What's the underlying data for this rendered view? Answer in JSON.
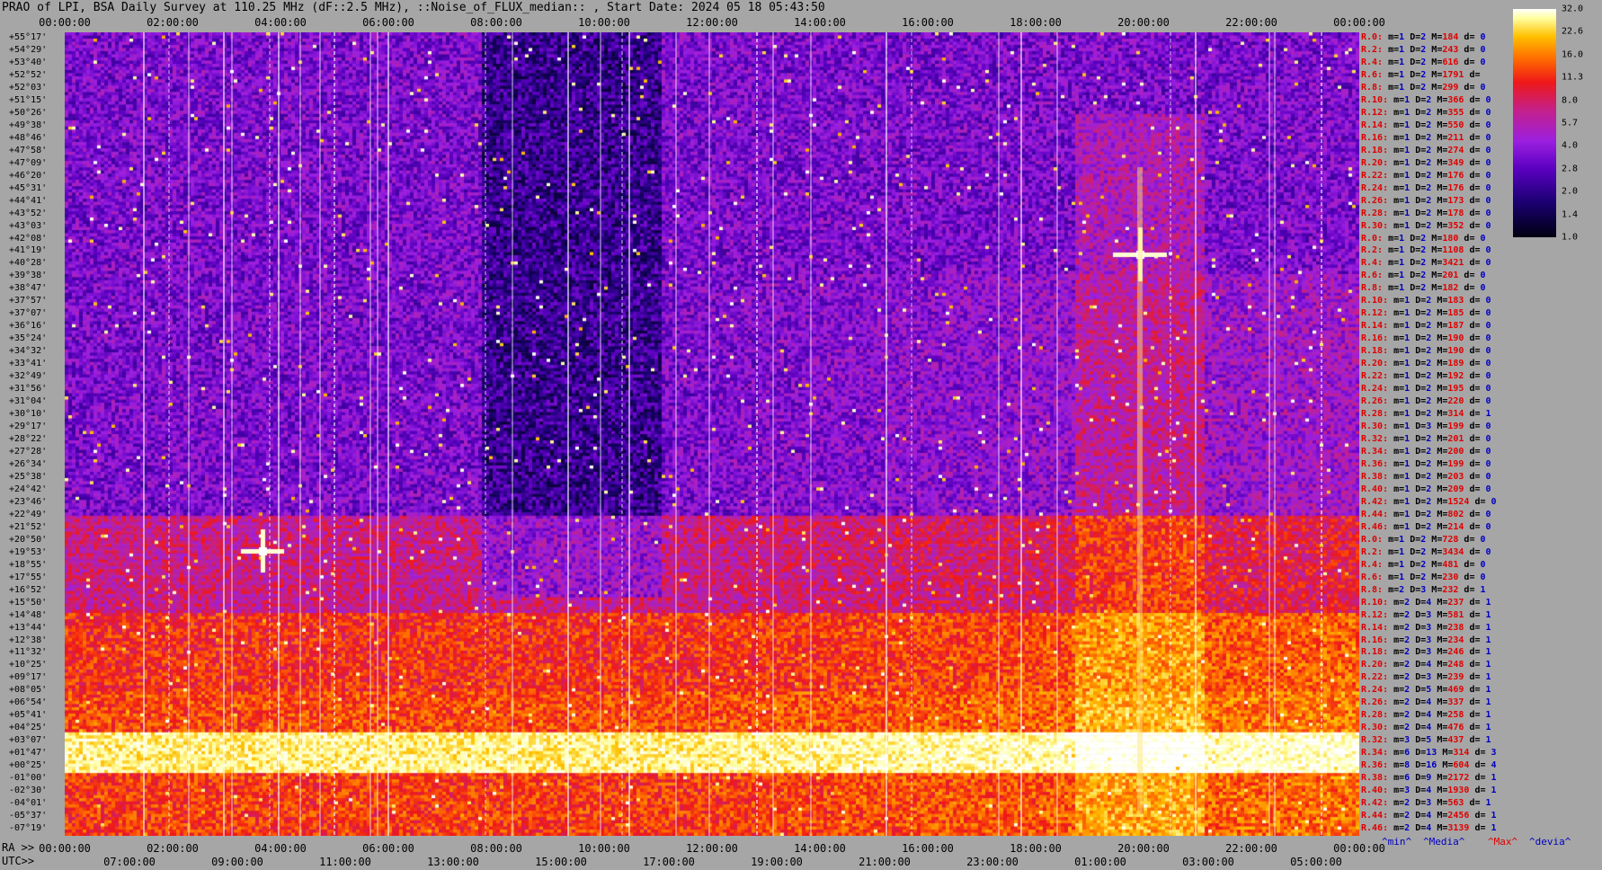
{
  "title": "PRAO of LPI, BSA Daily Survey at 110.25 MHz (dF::2.5 MHz), ::Noise_of_FLUX_median:: , Start Date: 2024 05 18 05:43:50",
  "chart_data": {
    "type": "heatmap",
    "top_axis_ticks": [
      "00:00:00",
      "02:00:00",
      "04:00:00",
      "06:00:00",
      "08:00:00",
      "10:00:00",
      "12:00:00",
      "14:00:00",
      "16:00:00",
      "18:00:00",
      "20:00:00",
      "22:00:00",
      "00:00:00"
    ],
    "ra_row_label": "RA >>",
    "ra_ticks": [
      "00:00:00",
      "02:00:00",
      "04:00:00",
      "06:00:00",
      "08:00:00",
      "10:00:00",
      "12:00:00",
      "14:00:00",
      "16:00:00",
      "18:00:00",
      "20:00:00",
      "22:00:00",
      "00:00:00"
    ],
    "utc_row_label": "UTC>>",
    "utc_ticks": [
      "07:00:00",
      "09:00:00",
      "11:00:00",
      "13:00:00",
      "15:00:00",
      "17:00:00",
      "19:00:00",
      "21:00:00",
      "23:00:00",
      "01:00:00",
      "03:00:00",
      "05:00:00"
    ],
    "declinations": [
      "+55°17'",
      "+54°29'",
      "+53°40'",
      "+52°52'",
      "+52°03'",
      "+51°15'",
      "+50°26'",
      "+49°38'",
      "+48°46'",
      "+47°58'",
      "+47°09'",
      "+46°20'",
      "+45°31'",
      "+44°41'",
      "+43°52'",
      "+43°03'",
      "+42°08'",
      "+41°19'",
      "+40°28'",
      "+39°38'",
      "+38°47'",
      "+37°57'",
      "+37°07'",
      "+36°16'",
      "+35°24'",
      "+34°32'",
      "+33°41'",
      "+32°49'",
      "+31°56'",
      "+31°04'",
      "+30°10'",
      "+29°17'",
      "+28°22'",
      "+27°28'",
      "+26°34'",
      "+25°38'",
      "+24°42'",
      "+23°46'",
      "+22°49'",
      "+21°52'",
      "+20°50'",
      "+19°53'",
      "+18°55'",
      "+17°55'",
      "+16°52'",
      "+15°50'",
      "+14°48'",
      "+13°44'",
      "+12°38'",
      "+11°32'",
      "+10°25'",
      "+09°17'",
      "+08°05'",
      "+06°54'",
      "+05°41'",
      "+04°25'",
      "+03°07'",
      "+01°47'",
      "+00°25'",
      "-01°00'",
      "-02°30'",
      "-04°01'",
      "-05°37'",
      "-07°19'"
    ],
    "colorbar_ticks": [
      "32.0",
      "22.6",
      "16.0",
      "11.3",
      "8.0",
      "5.7",
      "4.0",
      "2.8",
      "2.0",
      "1.4",
      "1.0"
    ],
    "colorbar_colors": [
      "#000010",
      "#1a0070",
      "#5a00c0",
      "#9b1fe0",
      "#c2208f",
      "#ef1818",
      "#ff6a00",
      "#ffc000",
      "#ffffa0",
      "#ffffff"
    ],
    "row_stats": [
      {
        "r": "R.0:",
        "m": "1",
        "D": "2",
        "M": "184",
        "d": "0"
      },
      {
        "r": "R.2:",
        "m": "1",
        "D": "2",
        "M": "243",
        "d": "0"
      },
      {
        "r": "R.4:",
        "m": "1",
        "D": "2",
        "M": "616",
        "d": "0"
      },
      {
        "r": "R.6:",
        "m": "1",
        "D": "2",
        "M": "1791",
        "d": ""
      },
      {
        "r": "R.8:",
        "m": "1",
        "D": "2",
        "M": "299",
        "d": "0"
      },
      {
        "r": "R.10:",
        "m": "1",
        "D": "2",
        "M": "366",
        "d": "0"
      },
      {
        "r": "R.12:",
        "m": "1",
        "D": "2",
        "M": "355",
        "d": "0"
      },
      {
        "r": "R.14:",
        "m": "1",
        "D": "2",
        "M": "550",
        "d": "0"
      },
      {
        "r": "R.16:",
        "m": "1",
        "D": "2",
        "M": "211",
        "d": "0"
      },
      {
        "r": "R.18:",
        "m": "1",
        "D": "2",
        "M": "274",
        "d": "0"
      },
      {
        "r": "R.20:",
        "m": "1",
        "D": "2",
        "M": "349",
        "d": "0"
      },
      {
        "r": "R.22:",
        "m": "1",
        "D": "2",
        "M": "176",
        "d": "0"
      },
      {
        "r": "R.24:",
        "m": "1",
        "D": "2",
        "M": "176",
        "d": "0"
      },
      {
        "r": "R.26:",
        "m": "1",
        "D": "2",
        "M": "173",
        "d": "0"
      },
      {
        "r": "R.28:",
        "m": "1",
        "D": "2",
        "M": "178",
        "d": "0"
      },
      {
        "r": "R.30:",
        "m": "1",
        "D": "2",
        "M": "352",
        "d": "0"
      },
      {
        "r": "R.0:",
        "m": "1",
        "D": "2",
        "M": "180",
        "d": "0"
      },
      {
        "r": "R.2:",
        "m": "1",
        "D": "2",
        "M": "1108",
        "d": "0"
      },
      {
        "r": "R.4:",
        "m": "1",
        "D": "2",
        "M": "3421",
        "d": "0"
      },
      {
        "r": "R.6:",
        "m": "1",
        "D": "2",
        "M": "201",
        "d": "0"
      },
      {
        "r": "R.8:",
        "m": "1",
        "D": "2",
        "M": "182",
        "d": "0"
      },
      {
        "r": "R.10:",
        "m": "1",
        "D": "2",
        "M": "183",
        "d": "0"
      },
      {
        "r": "R.12:",
        "m": "1",
        "D": "2",
        "M": "185",
        "d": "0"
      },
      {
        "r": "R.14:",
        "m": "1",
        "D": "2",
        "M": "187",
        "d": "0"
      },
      {
        "r": "R.16:",
        "m": "1",
        "D": "2",
        "M": "190",
        "d": "0"
      },
      {
        "r": "R.18:",
        "m": "1",
        "D": "2",
        "M": "190",
        "d": "0"
      },
      {
        "r": "R.20:",
        "m": "1",
        "D": "2",
        "M": "189",
        "d": "0"
      },
      {
        "r": "R.22:",
        "m": "1",
        "D": "2",
        "M": "192",
        "d": "0"
      },
      {
        "r": "R.24:",
        "m": "1",
        "D": "2",
        "M": "195",
        "d": "0"
      },
      {
        "r": "R.26:",
        "m": "1",
        "D": "2",
        "M": "220",
        "d": "0"
      },
      {
        "r": "R.28:",
        "m": "1",
        "D": "2",
        "M": "314",
        "d": "1"
      },
      {
        "r": "R.30:",
        "m": "1",
        "D": "3",
        "M": "199",
        "d": "0"
      },
      {
        "r": "R.32:",
        "m": "1",
        "D": "2",
        "M": "201",
        "d": "0"
      },
      {
        "r": "R.34:",
        "m": "1",
        "D": "2",
        "M": "200",
        "d": "0"
      },
      {
        "r": "R.36:",
        "m": "1",
        "D": "2",
        "M": "199",
        "d": "0"
      },
      {
        "r": "R.38:",
        "m": "1",
        "D": "2",
        "M": "203",
        "d": "0"
      },
      {
        "r": "R.40:",
        "m": "1",
        "D": "2",
        "M": "209",
        "d": "0"
      },
      {
        "r": "R.42:",
        "m": "1",
        "D": "2",
        "M": "1524",
        "d": "0"
      },
      {
        "r": "R.44:",
        "m": "1",
        "D": "2",
        "M": "802",
        "d": "0"
      },
      {
        "r": "R.46:",
        "m": "1",
        "D": "2",
        "M": "214",
        "d": "0"
      },
      {
        "r": "R.0:",
        "m": "1",
        "D": "2",
        "M": "728",
        "d": "0"
      },
      {
        "r": "R.2:",
        "m": "1",
        "D": "2",
        "M": "3434",
        "d": "0"
      },
      {
        "r": "R.4:",
        "m": "1",
        "D": "2",
        "M": "481",
        "d": "0"
      },
      {
        "r": "R.6:",
        "m": "1",
        "D": "2",
        "M": "230",
        "d": "0"
      },
      {
        "r": "R.8:",
        "m": "2",
        "D": "3",
        "M": "232",
        "d": "1"
      },
      {
        "r": "R.10:",
        "m": "2",
        "D": "4",
        "M": "237",
        "d": "1"
      },
      {
        "r": "R.12:",
        "m": "2",
        "D": "3",
        "M": "581",
        "d": "1"
      },
      {
        "r": "R.14:",
        "m": "2",
        "D": "3",
        "M": "238",
        "d": "1"
      },
      {
        "r": "R.16:",
        "m": "2",
        "D": "3",
        "M": "234",
        "d": "1"
      },
      {
        "r": "R.18:",
        "m": "2",
        "D": "3",
        "M": "246",
        "d": "1"
      },
      {
        "r": "R.20:",
        "m": "2",
        "D": "4",
        "M": "248",
        "d": "1"
      },
      {
        "r": "R.22:",
        "m": "2",
        "D": "3",
        "M": "239",
        "d": "1"
      },
      {
        "r": "R.24:",
        "m": "2",
        "D": "5",
        "M": "469",
        "d": "1"
      },
      {
        "r": "R.26:",
        "m": "2",
        "D": "4",
        "M": "337",
        "d": "1"
      },
      {
        "r": "R.28:",
        "m": "2",
        "D": "4",
        "M": "258",
        "d": "1"
      },
      {
        "r": "R.30:",
        "m": "2",
        "D": "4",
        "M": "476",
        "d": "1"
      },
      {
        "r": "R.32:",
        "m": "3",
        "D": "5",
        "M": "437",
        "d": "1"
      },
      {
        "r": "R.34:",
        "m": "6",
        "D": "13",
        "M": "314",
        "d": "3"
      },
      {
        "r": "R.36:",
        "m": "8",
        "D": "16",
        "M": "604",
        "d": "4"
      },
      {
        "r": "R.38:",
        "m": "6",
        "D": "9",
        "M": "2172",
        "d": "1"
      },
      {
        "r": "R.40:",
        "m": "3",
        "D": "4",
        "M": "1930",
        "d": "1"
      },
      {
        "r": "R.42:",
        "m": "2",
        "D": "3",
        "M": "563",
        "d": "1"
      },
      {
        "r": "R.44:",
        "m": "2",
        "D": "4",
        "M": "2456",
        "d": "1"
      },
      {
        "r": "R.46:",
        "m": "2",
        "D": "4",
        "M": "3139",
        "d": "1"
      }
    ],
    "legend": {
      "min": "^min^",
      "media": "^Media^",
      "max": "^Max^",
      "devia": "^devia^"
    }
  }
}
